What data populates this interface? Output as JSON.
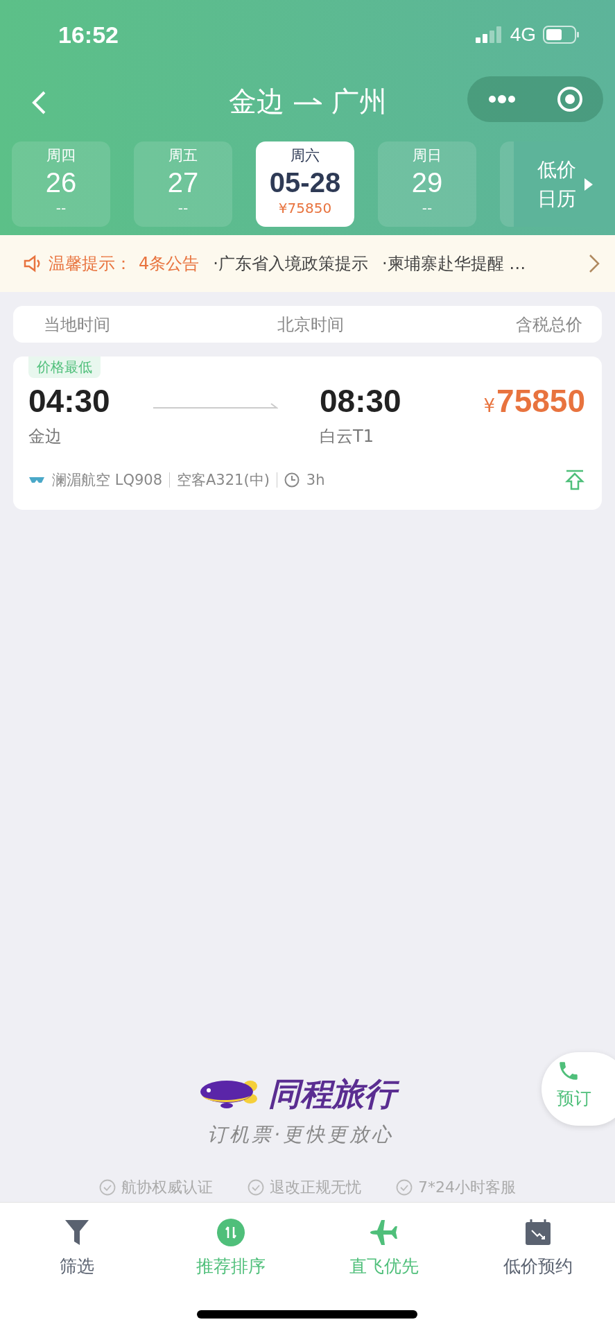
{
  "status_bar": {
    "time": "16:52",
    "network": "4G"
  },
  "nav": {
    "from": "金边",
    "to": "广州"
  },
  "dates": [
    {
      "weekday": "周四",
      "date": "26",
      "price": "--",
      "selected": false
    },
    {
      "weekday": "周五",
      "date": "27",
      "price": "--",
      "selected": false
    },
    {
      "weekday": "周六",
      "date": "05-28",
      "price": "¥75850",
      "selected": true
    },
    {
      "weekday": "周日",
      "date": "29",
      "price": "--",
      "selected": false
    }
  ],
  "calendar_button": [
    "低价",
    "日历"
  ],
  "notice": {
    "label": "温馨提示：",
    "count": "4条公告",
    "items": [
      "·广东省入境政策提示",
      "·柬埔寨赴华提醒 …"
    ]
  },
  "columns": [
    "当地时间",
    "北京时间",
    "含税总价"
  ],
  "flights": [
    {
      "tag": "价格最低",
      "dep_time": "04:30",
      "dep_airport": "金边",
      "arr_time": "08:30",
      "arr_airport": "白云T1",
      "currency": "¥",
      "price": "75850",
      "airline": "澜湄航空 LQ908",
      "aircraft": "空客A321(中)",
      "duration": "3h"
    }
  ],
  "brand": {
    "name": "同程旅行",
    "slogan": "订机票·更快更放心"
  },
  "guarantees": [
    "航协权威认证",
    "退改正规无忧",
    "7*24小时客服"
  ],
  "call_button": {
    "label": "预订"
  },
  "bottom_tabs": [
    {
      "kind": "filter",
      "label": "筛选",
      "selected": false
    },
    {
      "kind": "sort",
      "label": "推荐排序",
      "selected": true
    },
    {
      "kind": "direct",
      "label": "直飞优先",
      "selected": true
    },
    {
      "kind": "calendar",
      "label": "低价预约",
      "selected": false
    }
  ]
}
